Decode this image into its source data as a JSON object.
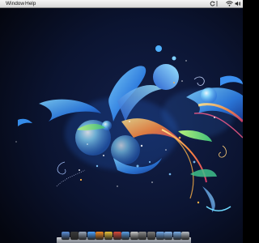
{
  "menubar": {
    "items": [
      {
        "label": "Window"
      },
      {
        "label": "Help"
      }
    ],
    "status_icons": [
      "sync-icon",
      "wifi-icon",
      "volume-icon"
    ]
  },
  "desktop": {
    "wallpaper": "abstract-blue-swirls",
    "colors": {
      "background": "#0b1024",
      "swirl_blue": "#2f8df0",
      "swirl_cyan": "#6fd9ff",
      "accent_orange": "#ff9a3c",
      "accent_green": "#7ed957"
    }
  },
  "dock": {
    "icons": [
      {
        "name": "finder-icon",
        "color": "#5b8fd9"
      },
      {
        "name": "dashboard-icon",
        "color": "#3a3a3a"
      },
      {
        "name": "mail-icon",
        "color": "#9aa7b8"
      },
      {
        "name": "safari-icon",
        "color": "#4da3ff"
      },
      {
        "name": "firefox-icon",
        "color": "#f08a24"
      },
      {
        "name": "chrome-icon",
        "color": "#e7c23a"
      },
      {
        "name": "app-icon",
        "color": "#d84a3a"
      },
      {
        "name": "itunes-icon",
        "color": "#5aa0e6"
      },
      {
        "name": "photos-icon",
        "color": "#c7c7c7"
      },
      {
        "name": "preview-icon",
        "color": "#8a8a8a"
      },
      {
        "name": "system-preferences-icon",
        "color": "#7a7a7a"
      },
      {
        "name": "folder-icon",
        "color": "#6ea6e8"
      },
      {
        "name": "documents-folder-icon",
        "color": "#86b6ee"
      },
      {
        "name": "downloads-folder-icon",
        "color": "#7aaee8"
      },
      {
        "name": "trash-icon",
        "color": "#b8bec6"
      }
    ]
  }
}
